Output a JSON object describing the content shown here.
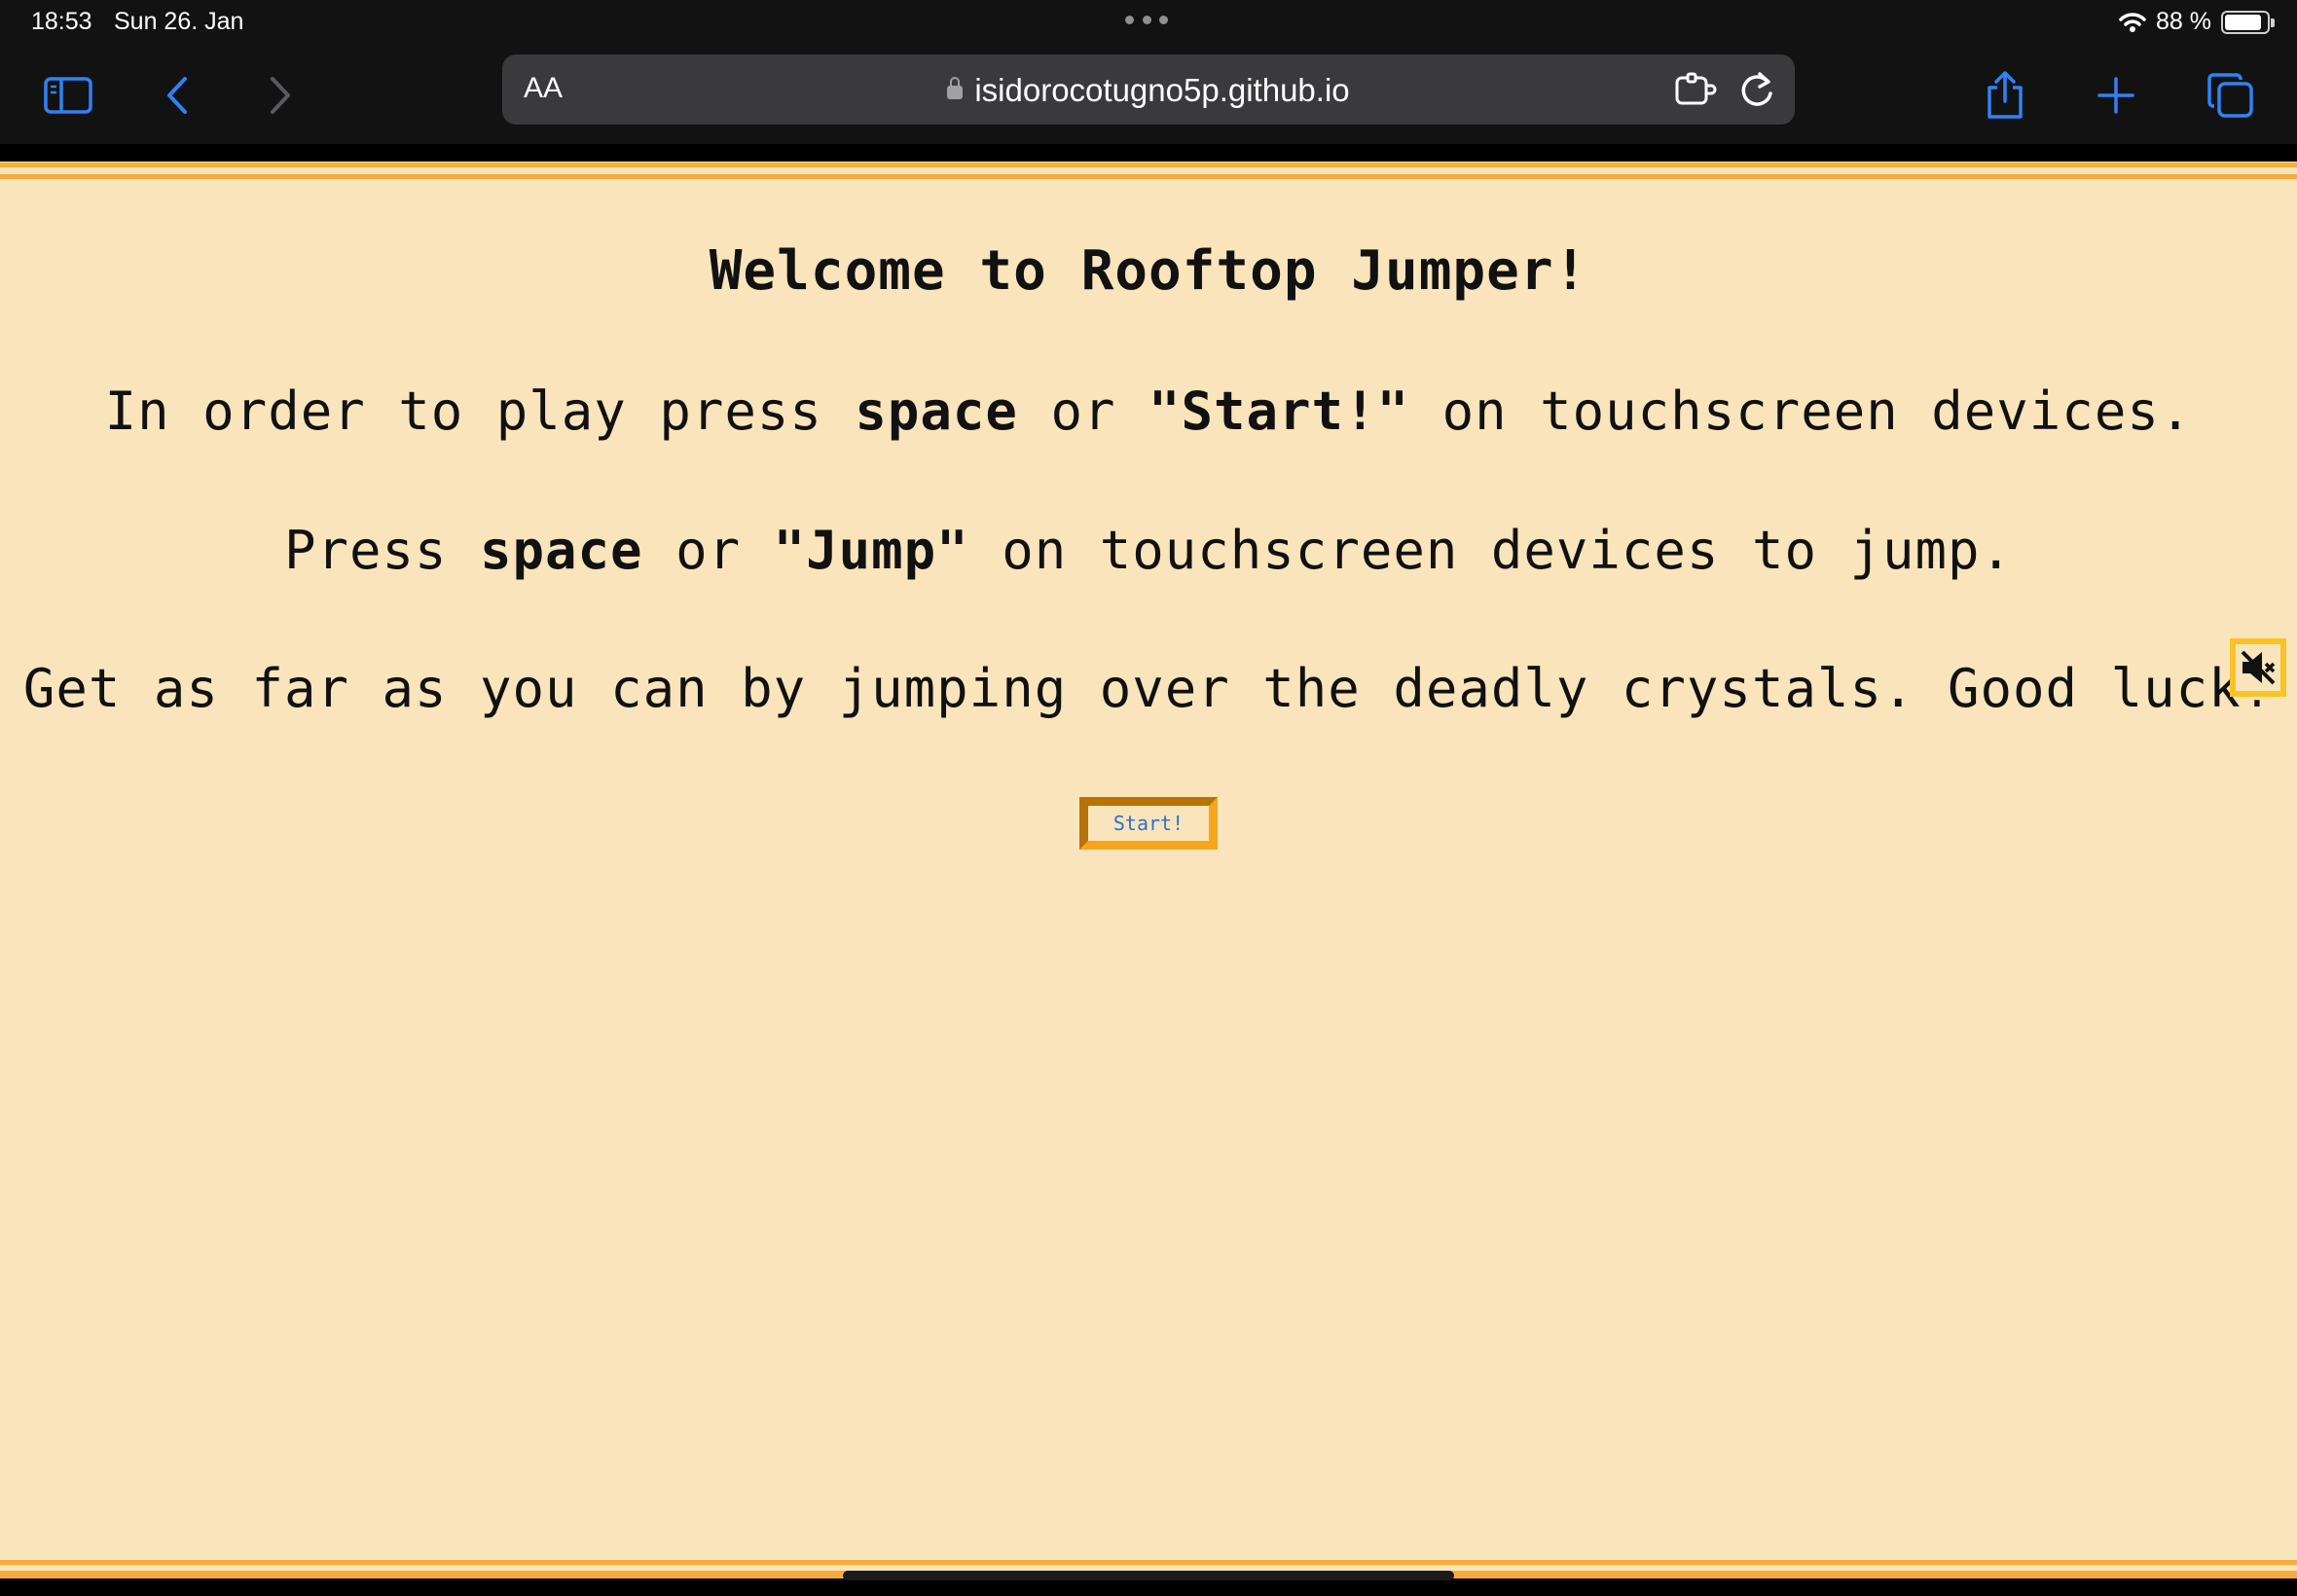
{
  "status_bar": {
    "time": "18:53",
    "date": "Sun 26. Jan",
    "battery": "88 %",
    "battery_level": 0.88
  },
  "toolbar": {
    "aa_label": "AA",
    "url": "isidorocotugno5p.github.io",
    "icons": [
      "sidebar-icon",
      "back-icon",
      "forward-icon",
      "extension-icon",
      "reload-icon",
      "share-icon",
      "new-tab-icon",
      "tabs-icon"
    ],
    "accent_color": "#2f82f6"
  },
  "game": {
    "title": "Welcome to Rooftop Jumper!",
    "line1": {
      "a": "In order to play press ",
      "b": "space",
      "c": " or ",
      "d": "\"Start!\"",
      "e": " on touchscreen devices."
    },
    "line2": {
      "a": "Press ",
      "b": "space",
      "c": " or ",
      "d": "\"Jump\"",
      "e": " on touchscreen devices to jump."
    },
    "line3": "Get as far as you can by jumping over the deadly crystals. Good luck!",
    "start_button": "Start!",
    "mute_icon": "speaker-muted-icon",
    "background_color": "#fae4bb",
    "border_color": "#f5ac3a"
  }
}
